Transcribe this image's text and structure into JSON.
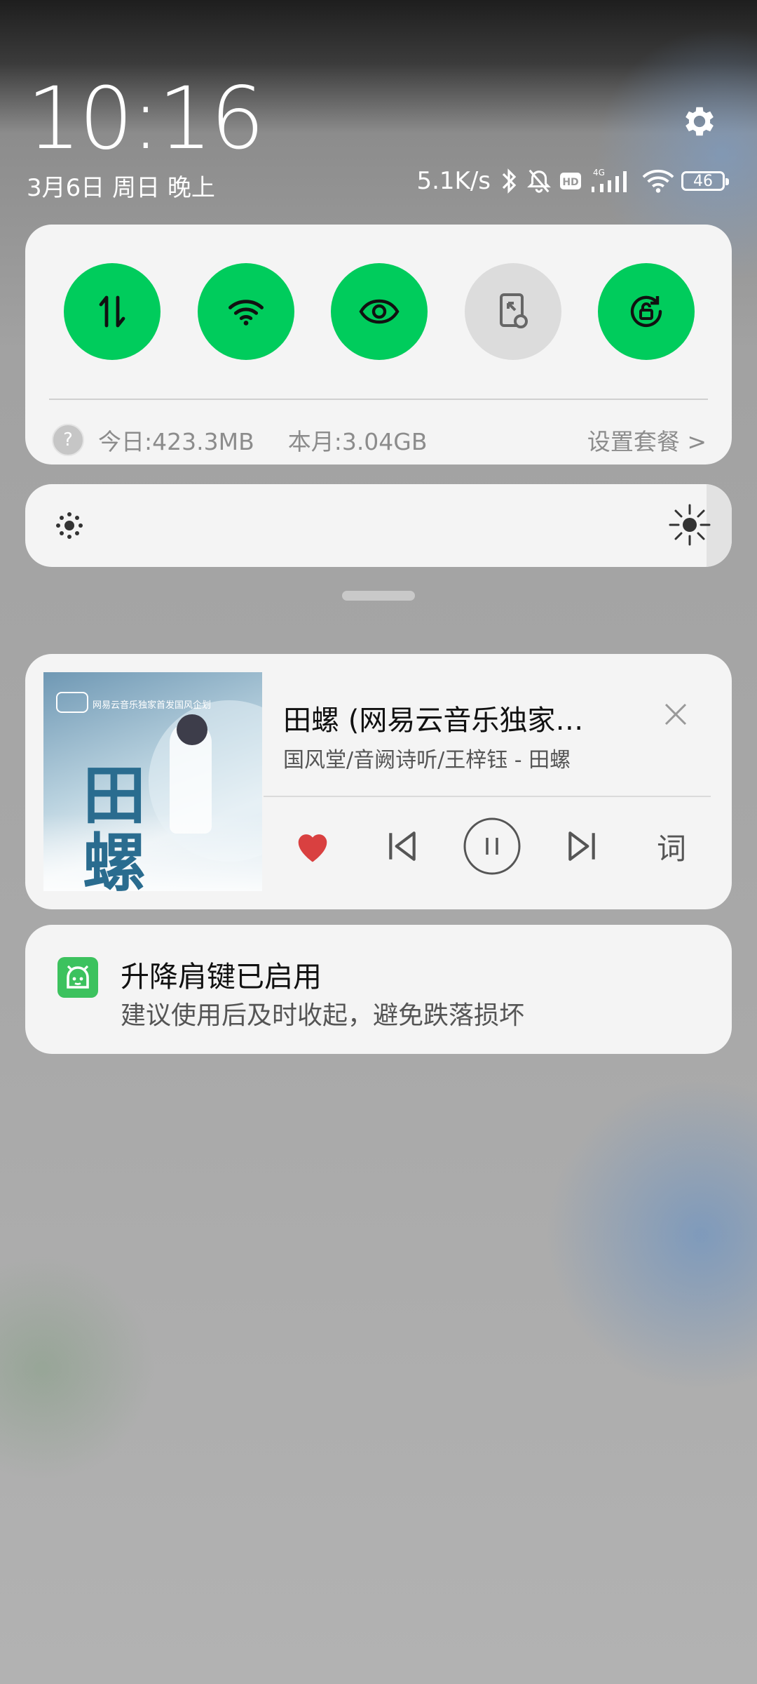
{
  "status_bar": {
    "time": "10:16",
    "date": "3月6日 周日 晚上",
    "net_speed": "5.1K/s",
    "battery": "46",
    "signal_type": "4G",
    "icons": [
      "bluetooth-icon",
      "mute-icon",
      "hd-icon",
      "signal-icon",
      "wifi-icon",
      "battery-icon"
    ]
  },
  "quick_settings": {
    "toggles": [
      {
        "name": "mobile-data",
        "icon": "data-arrows-icon",
        "active": true
      },
      {
        "name": "wifi",
        "icon": "wifi-icon",
        "active": true
      },
      {
        "name": "eye-comfort",
        "icon": "eye-icon",
        "active": true
      },
      {
        "name": "screencast",
        "icon": "screencast-icon",
        "active": false
      },
      {
        "name": "rotation-lock",
        "icon": "rotation-lock-icon",
        "active": true
      }
    ],
    "data_usage": {
      "help": "?",
      "today": "今日:423.3MB",
      "month": "本月:3.04GB",
      "plan_link": "设置套餐 >"
    }
  },
  "brightness": {
    "level": 0.05
  },
  "media": {
    "title": "田螺 (网易云音乐独家…",
    "artist": "国风堂/音阙诗听/王梓钰 - 田螺",
    "album_art_text": "田螺",
    "album_caption": "网易云音乐独家首发国风企划",
    "lyrics_label": "词",
    "liked": true,
    "accent_color": "#d94040"
  },
  "notification": {
    "title": "升降肩键已启用",
    "body": "建议使用后及时收起，避免跌落损坏",
    "app_icon": "android-robot-icon",
    "icon_color": "#3cc25e"
  },
  "colors": {
    "toggle_on": "#00cc5c",
    "toggle_off": "#dcdcdc"
  }
}
